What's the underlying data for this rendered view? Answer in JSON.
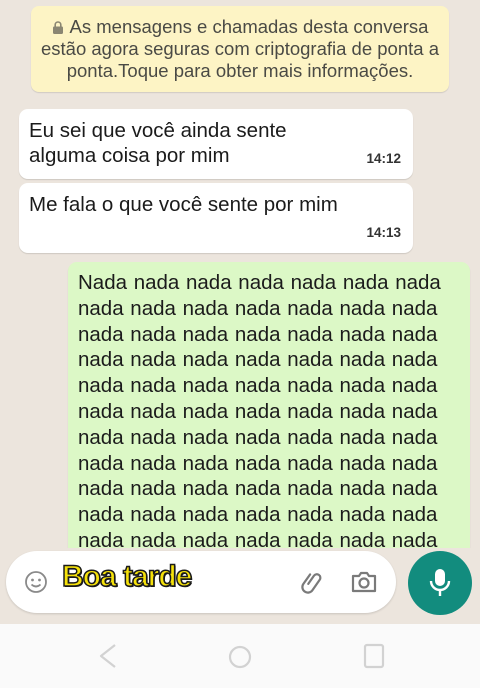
{
  "encryption_notice": {
    "text": "As mensagens e chamadas desta conversa estão agora seguras com criptografia de ponta a ponta.Toque para obter mais informações.",
    "icon": "lock-icon"
  },
  "messages": [
    {
      "direction": "incoming",
      "text": "Eu sei que você ainda sente alguma coisa por mim",
      "time": "14:12"
    },
    {
      "direction": "incoming",
      "text": "Me fala o que você sente por mim",
      "time": "14:13"
    },
    {
      "direction": "outgoing",
      "text": "Nada nada nada nada nada nada nada\nnada nada nada nada nada nada nada\nnada nada nada nada nada nada nada\nnada nada nada nada nada nada nada\nnada nada nada nada nada nada nada\nnada nada nada nada nada nada nada\nnada nada nada nada nada nada nada\nnada nada nada nada nada nada nada\nnada nada nada nada nada nada nada\nnada nada nada nada nada nada nada\nnada nada nada nada nada nada nada"
    }
  ],
  "composer": {
    "overlay_text": "Boa tarde",
    "emoji_icon": "emoji-icon",
    "attach_icon": "paperclip-icon",
    "camera_icon": "camera-icon",
    "mic_icon": "microphone-icon"
  },
  "colors": {
    "outgoing_bubble": "#dcf8c6",
    "incoming_bubble": "#ffffff",
    "notice_bg": "#fdf4c5",
    "mic_button": "#128c7e",
    "sticker_text": "#f5e10a"
  }
}
